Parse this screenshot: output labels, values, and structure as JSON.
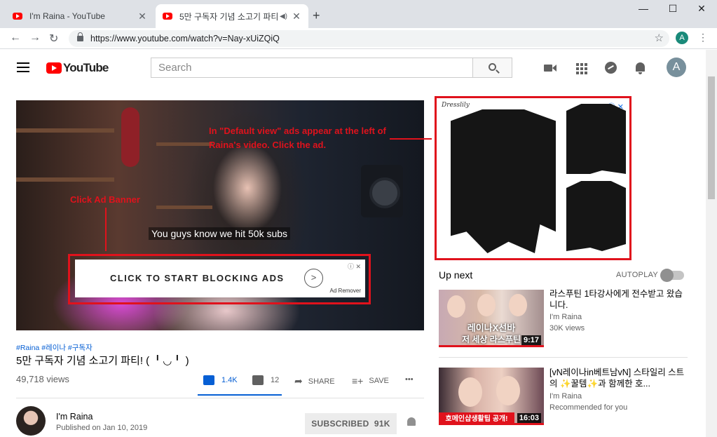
{
  "browser": {
    "tabs": [
      {
        "title": "I'm Raina - YouTube",
        "close": "✕"
      },
      {
        "title": "5만 구독자 기념 소고기 파티",
        "close": "✕"
      }
    ],
    "new_tab": "+",
    "window_controls": [
      "—",
      "☐",
      "✕"
    ],
    "nav": {
      "back": "←",
      "forward": "→",
      "reload": "↻"
    },
    "url": "https://www.youtube.com/watch?v=Nay-xUiZQiQ",
    "profile_initial": "A",
    "menu": "⋮",
    "star": "☆"
  },
  "masthead": {
    "logo_text": "YouTube",
    "search_placeholder": "Search",
    "avatar_initial": "A"
  },
  "video": {
    "caption": "You guys know we hit 50k subs",
    "hashtags": "#Raina #레이나 #구독자",
    "title": "5만 구독자 기념 소고기 파티! ( ╹◡╹ )",
    "views": "49,718 views",
    "likes": "1.4K",
    "dislikes": "12",
    "share": "SHARE",
    "save": "SAVE",
    "more": "•••"
  },
  "ad_banner": {
    "cta": "CLICK TO START BLOCKING ADS",
    "brand": "Ad Remover",
    "arrow": ">",
    "close": "ⓘ ✕"
  },
  "annotations": {
    "side_note": "In \"Default view\" ads appear at the left of Raina's video. Click the ad.",
    "banner_note": "Click Ad Banner"
  },
  "channel": {
    "name": "I'm Raina",
    "published": "Published on Jan 10, 2019",
    "subscribe_label": "SUBSCRIBED",
    "subscribers": "91K"
  },
  "side_ad": {
    "logo": "Dresslily",
    "close": "ⓘ ✕"
  },
  "up_next": {
    "heading": "Up next",
    "autoplay": "AUTOPLAY",
    "items": [
      {
        "title": "라스푸틴 1타강사에게 전수받고 왔습니다.",
        "channel": "I'm Raina",
        "meta": "30K views",
        "duration": "9:17",
        "thumb_text_top": "레이나X선바",
        "thumb_text_bottom": "저 세상 라스푸틴"
      },
      {
        "title": "[vN레이나in베트남vN] 스타일리 스트의 ✨꿀템✨과 함께한 호...",
        "channel": "I'm Raina",
        "meta": "Recommended for you",
        "duration": "16:03",
        "thumb_text_bottom": "호메인샵생활팁 공개!"
      }
    ]
  }
}
